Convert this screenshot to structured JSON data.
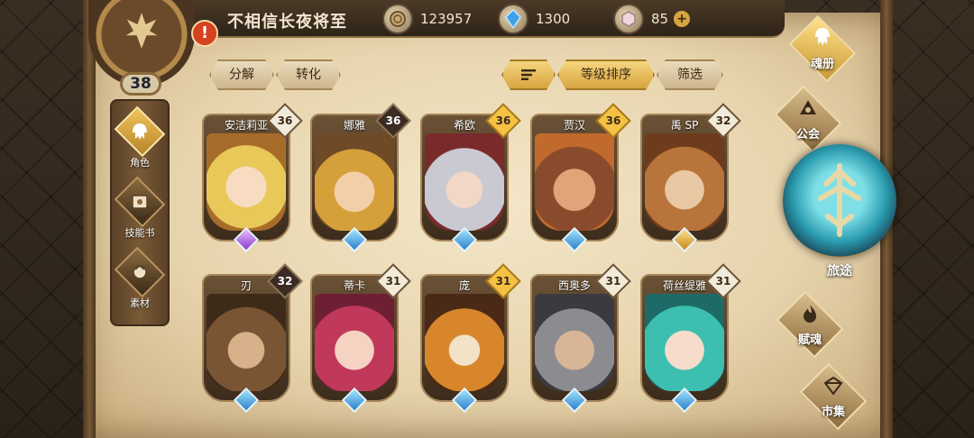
{
  "player": {
    "name": "不相信长夜将至",
    "level": "38",
    "alert": "!"
  },
  "currencies": [
    {
      "icon": "coin-icon",
      "value": "123957"
    },
    {
      "icon": "crystal-icon",
      "value": "1300"
    },
    {
      "icon": "gem-icon",
      "value": "85"
    }
  ],
  "side_nav": [
    {
      "label": "角色",
      "icon": "helmet-icon",
      "active": true
    },
    {
      "label": "技能书",
      "icon": "skill-book-icon",
      "active": false
    },
    {
      "label": "素材",
      "icon": "material-icon",
      "active": false
    }
  ],
  "toolbar": {
    "decompose": "分解",
    "convert": "转化",
    "sort_label": "等级排序",
    "filter_label": "筛选"
  },
  "heroes": [
    {
      "name": "安洁莉亚",
      "level": "36",
      "badge": "light",
      "gem": "purple",
      "color": "#e9c85a"
    },
    {
      "name": "娜雅",
      "level": "36",
      "badge": "dark",
      "gem": "blue",
      "color": "#d59f3a"
    },
    {
      "name": "希欧",
      "level": "36",
      "badge": "gold",
      "gem": "blue",
      "color": "#c9c9d2"
    },
    {
      "name": "贾汉",
      "level": "36",
      "badge": "gold",
      "gem": "blue",
      "color": "#8a4a2c"
    },
    {
      "name": "禹 SP",
      "level": "32",
      "badge": "light",
      "gem": "gold",
      "color": "#b8743a"
    },
    {
      "name": "刃",
      "level": "32",
      "badge": "dark",
      "gem": "blue",
      "color": "#7a5534"
    },
    {
      "name": "蒂卡",
      "level": "31",
      "badge": "light",
      "gem": "blue",
      "color": "#c0385a"
    },
    {
      "name": "庞",
      "level": "31",
      "badge": "gold",
      "gem": "blue",
      "color": "#d8862c"
    },
    {
      "name": "西奥多",
      "level": "31",
      "badge": "light",
      "gem": "blue",
      "color": "#8c8c90"
    },
    {
      "name": "荷丝缇雅",
      "level": "31",
      "badge": "light",
      "gem": "blue",
      "color": "#3cbfb0"
    }
  ],
  "right_nav": {
    "soul_book": "魂册",
    "guild": "公会",
    "journey": "旅途",
    "endow": "赋魂",
    "market": "市集"
  },
  "colors": {
    "parchment": "#ecdcb8",
    "gold": "#e2b04a",
    "frame": "#6b5236",
    "journey_cyan": "#2b9cb0"
  }
}
